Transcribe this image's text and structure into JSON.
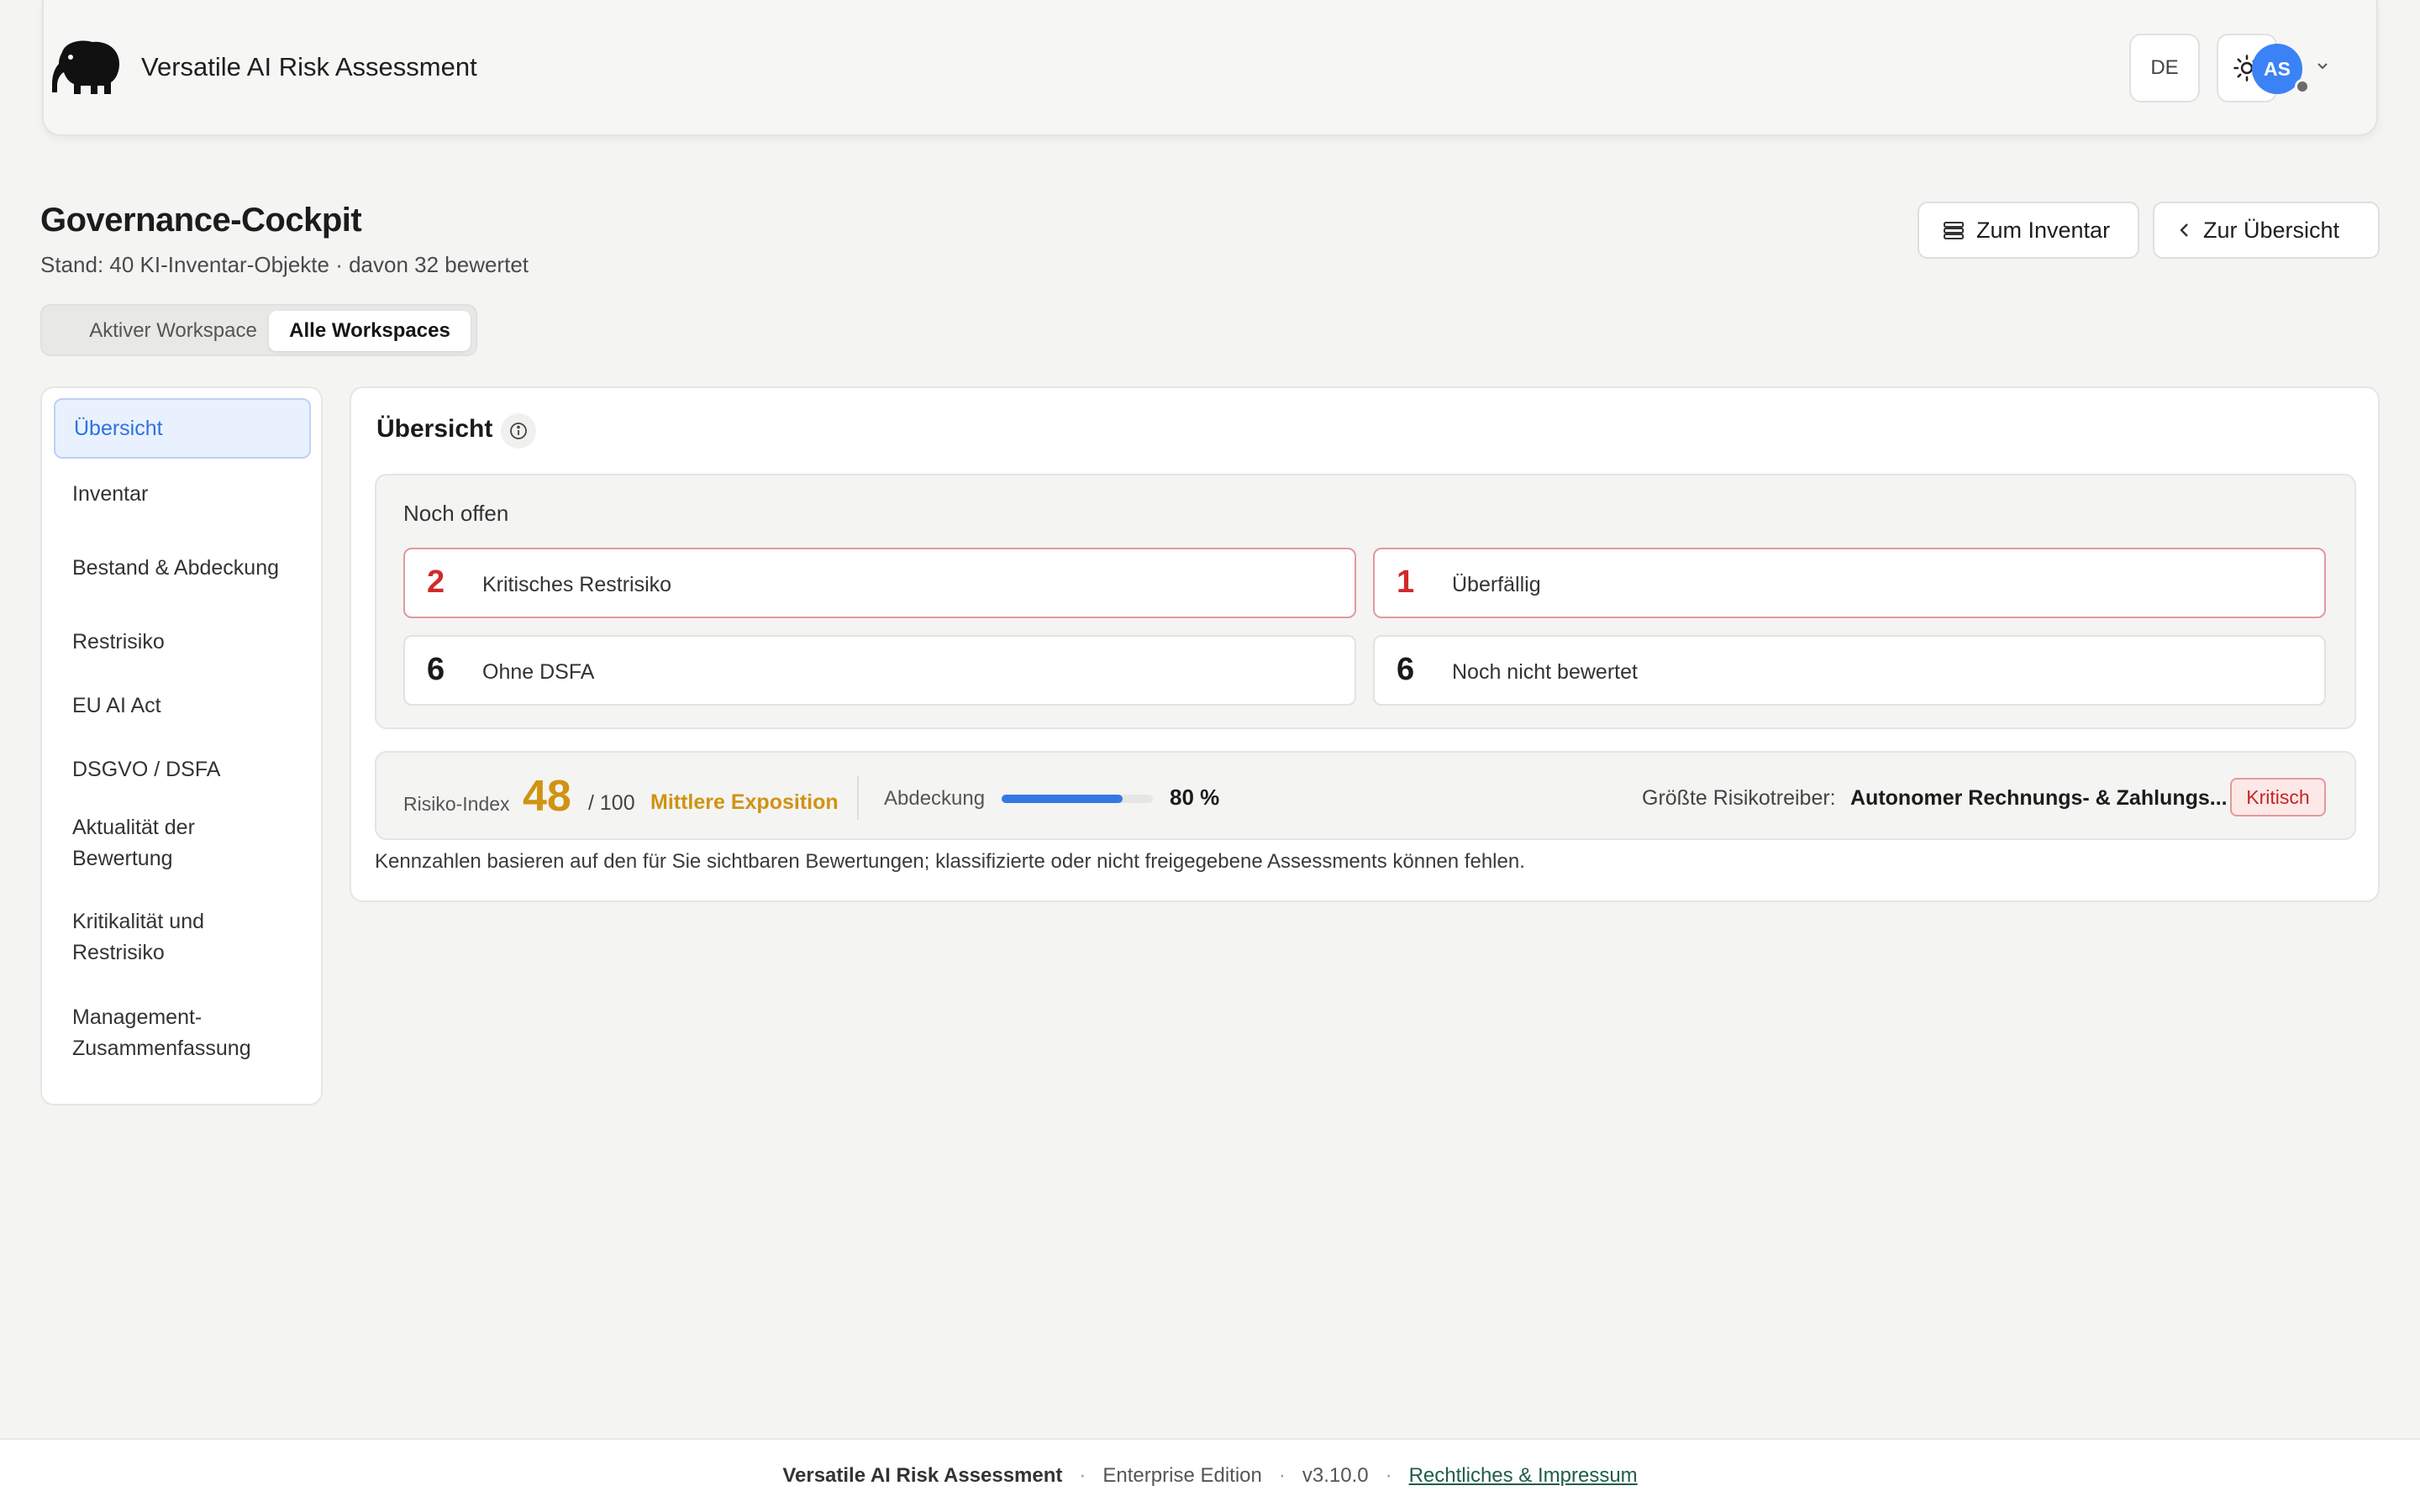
{
  "header": {
    "app_title": "Versatile AI Risk Assessment",
    "lang": "DE",
    "user_initials": "AS",
    "logo_icon": "elephant-icon",
    "theme_icon": "sun-icon"
  },
  "page": {
    "title": "Governance-Cockpit",
    "subtitle": "Stand: 40 KI-Inventar-Objekte · davon 32 bewertet",
    "actions": {
      "inventory": "Zum Inventar",
      "overview": "Zur Übersicht"
    },
    "scope_tabs": [
      "Aktiver Workspace",
      "Alle Workspaces"
    ],
    "scope_selected": "Alle Workspaces"
  },
  "sidebar": {
    "items": [
      {
        "label": "Übersicht",
        "active": true
      },
      {
        "label": "Inventar"
      },
      {
        "label": "Bestand & Abdeckung"
      },
      {
        "label": "Restrisiko"
      },
      {
        "label": "EU AI Act"
      },
      {
        "label": "DSGVO / DSFA"
      },
      {
        "label": "Aktualität der Bewertung"
      },
      {
        "label": "Kritikalität und Restrisiko"
      },
      {
        "label": "Management-Zusammenfassung"
      }
    ]
  },
  "overview": {
    "title": "Übersicht",
    "open": {
      "title": "Noch offen",
      "cards": [
        {
          "value": "2",
          "label": "Kritisches Restrisiko",
          "severity": "danger"
        },
        {
          "value": "1",
          "label": "Überfällig",
          "severity": "danger"
        },
        {
          "value": "6",
          "label": "Ohne DSFA",
          "severity": "neutral"
        },
        {
          "value": "6",
          "label": "Noch nicht bewertet",
          "severity": "neutral"
        }
      ]
    },
    "risk": {
      "index_label": "Risiko-Index",
      "index_value": "48",
      "index_max": "/ 100",
      "level": "Mittlere Exposition",
      "coverage_label": "Abdeckung",
      "coverage_value": "80 %",
      "coverage_fraction": 0.8,
      "driver_label": "Größte Risikotreiber:",
      "driver_value": "Autonomer Rechnungs- & Zahlungs...",
      "driver_badge": "Kritisch"
    },
    "footnote": "Kennzahlen basieren auf den für Sie sichtbaren Bewertungen; klassifizierte oder nicht freigegebene Assessments können fehlen."
  },
  "colors": {
    "accent": "#3b82f6",
    "warning": "#d09312",
    "danger": "#d12a2a"
  },
  "footer": {
    "product": "Versatile AI Risk Assessment",
    "edition": "Enterprise Edition",
    "version": "v3.10.0",
    "legal_link": "Rechtliches & Impressum"
  }
}
